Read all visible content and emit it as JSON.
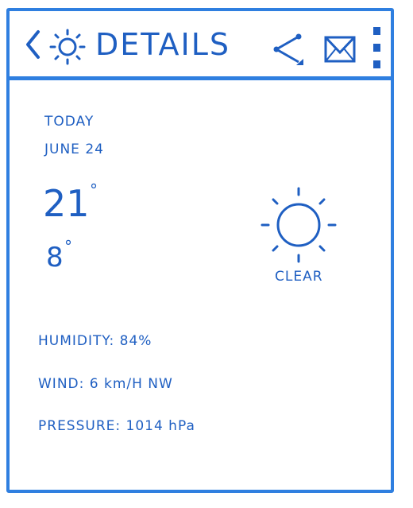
{
  "appbar": {
    "title": "DETAILS",
    "back_icon": "chevron-left-icon",
    "app_icon": "sun-icon",
    "share_icon": "share-icon",
    "mail_icon": "mail-icon",
    "menu_icon": "overflow-menu-icon"
  },
  "forecast": {
    "day": "TODAY",
    "date": "JUNE 24",
    "high": "21",
    "low": "8",
    "degree_symbol": "°",
    "condition": "CLEAR",
    "condition_icon": "sun-icon"
  },
  "details": {
    "humidity": "HUMIDITY: 84%",
    "wind": "WIND: 6 km/H NW",
    "pressure": "PRESSURE: 1014 hPa"
  },
  "colors": {
    "accent": "#2f7fe0",
    "text": "#1f5fc2"
  }
}
